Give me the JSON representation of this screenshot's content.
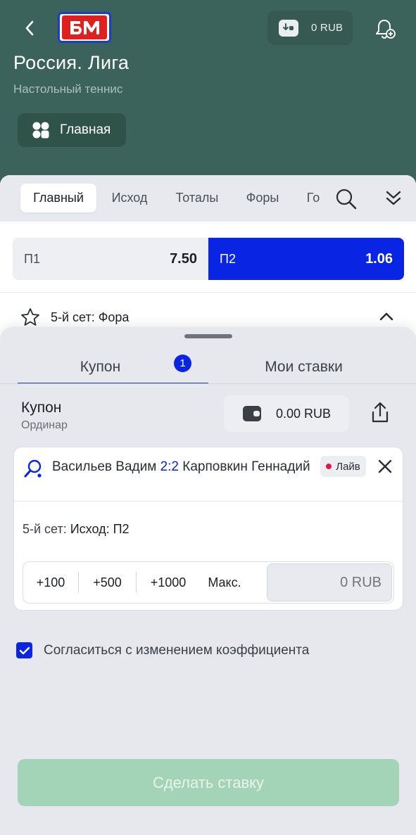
{
  "header": {
    "logo_text": "БМ",
    "wallet_balance": "0 RUB",
    "league_title": "Россия. Лига",
    "sport_name": "Настольный теннис",
    "main_chip_label": "Главная"
  },
  "market_tabs": [
    "Главный",
    "Исход",
    "Тоталы",
    "Форы",
    "Го"
  ],
  "odds": {
    "p1_label": "П1",
    "p1_value": "7.50",
    "p2_label": "П2",
    "p2_value": "1.06"
  },
  "market_row": {
    "label": "5-й сет: Фора"
  },
  "sheet": {
    "tab_coupon": "Купон",
    "coupon_count": "1",
    "tab_my_bets": "Мои ставки",
    "coupon_title": "Купон",
    "coupon_type": "Ординар",
    "balance": "0.00 RUB"
  },
  "bet": {
    "player1": "Васильев Вадим",
    "score": "2:2",
    "player2": "Карповкин Геннадий",
    "live_label": "Лайв",
    "pick_prefix": "5-й сет:",
    "pick_value": "Исход: П2",
    "quick_amounts": [
      "+100",
      "+500",
      "+1000",
      "Макс."
    ],
    "stake_placeholder": "0 RUB"
  },
  "agree_label": "Согласиться с изменением коэффициента",
  "submit_label": "Сделать ставку",
  "colors": {
    "header_bg": "#3c635b",
    "accent_blue": "#0a24e3",
    "submit_disabled": "#a4d4b7",
    "live_dot": "#e3164b"
  }
}
